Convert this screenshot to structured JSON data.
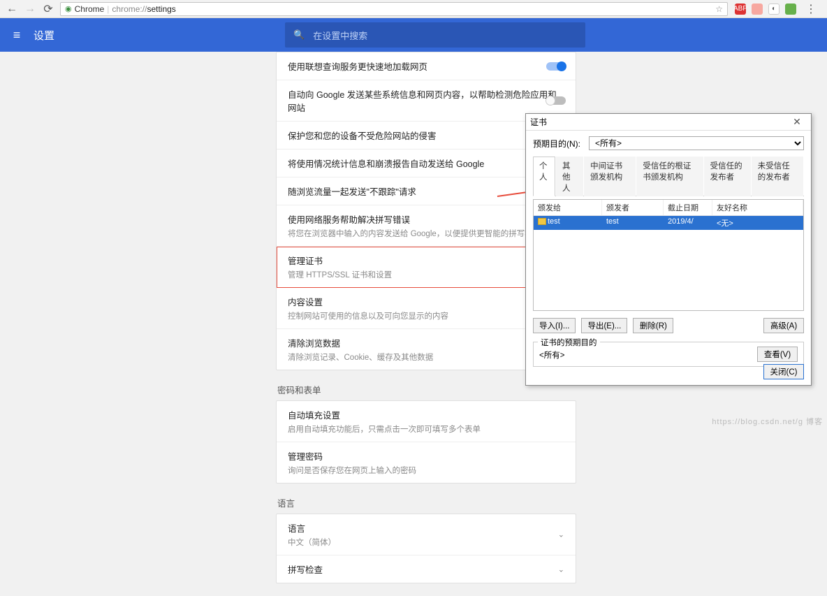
{
  "toolbar": {
    "secure_label": "Chrome",
    "url_prefix": "chrome://",
    "url_path": "settings"
  },
  "header": {
    "title": "设置",
    "search_placeholder": "在设置中搜索"
  },
  "settings": {
    "rows": [
      {
        "t": "使用联想查询服务更快速地加载网页",
        "s": null,
        "toggle": "on"
      },
      {
        "t": "自动向 Google 发送某些系统信息和网页内容，以帮助检测危险应用和网站",
        "s": null,
        "toggle": "off"
      },
      {
        "t": "保护您和您的设备不受危险网站的侵害",
        "s": null,
        "toggle": "on"
      },
      {
        "t": "将使用情况统计信息和崩溃报告自动发送给 Google",
        "s": null,
        "toggle": null
      },
      {
        "t": "随浏览流量一起发送\"不跟踪\"请求",
        "s": null,
        "toggle": null
      },
      {
        "t": "使用网络服务帮助解决拼写错误",
        "s": "将您在浏览器中输入的内容发送给 Google，以便提供更智能的拼写检查功能",
        "toggle": null
      },
      {
        "t": "管理证书",
        "s": "管理 HTTPS/SSL 证书和设置",
        "toggle": null,
        "highlight": true
      },
      {
        "t": "内容设置",
        "s": "控制网站可使用的信息以及可向您显示的内容",
        "toggle": null
      },
      {
        "t": "清除浏览数据",
        "s": "清除浏览记录、Cookie、缓存及其他数据",
        "toggle": null
      }
    ],
    "section_pw": "密码和表单",
    "pw_rows": [
      {
        "t": "自动填充设置",
        "s": "启用自动填充功能后，只需点击一次即可填写多个表单"
      },
      {
        "t": "管理密码",
        "s": "询问是否保存您在网页上输入的密码"
      }
    ],
    "section_lang": "语言",
    "lang_rows": [
      {
        "t": "语言",
        "s": "中文（简体）",
        "chev": true
      },
      {
        "t": "拼写检查",
        "s": null,
        "chev": true
      }
    ]
  },
  "cert": {
    "title": "证书",
    "purpose_label": "预期目的(N):",
    "purpose_value": "<所有>",
    "tabs": [
      "个人",
      "其他人",
      "中间证书颁发机构",
      "受信任的根证书颁发机构",
      "受信任的发布者",
      "未受信任的发布者"
    ],
    "cols": [
      "颁发给",
      "颁发者",
      "截止日期",
      "友好名称"
    ],
    "row": {
      "to": "test",
      "by": "test",
      "exp": "2019/4/",
      "name": "<无>"
    },
    "btn_import": "导入(I)...",
    "btn_export": "导出(E)...",
    "btn_delete": "删除(R)",
    "btn_adv": "高级(A)",
    "pb_title": "证书的预期目的",
    "pb_value": "<所有>",
    "btn_view": "查看(V)",
    "btn_close": "关闭(C)"
  },
  "watermark": "https://blog.csdn.net/g  博客"
}
